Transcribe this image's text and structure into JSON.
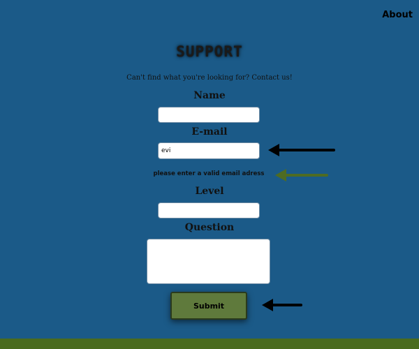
{
  "nav": {
    "about_label": "About"
  },
  "header": {
    "title": "SUPPORT",
    "subtitle": "Can't find what you're looking for? Contact us!"
  },
  "form": {
    "name_label": "Name",
    "name_value": "",
    "email_label": "E-mail",
    "email_value": "evi",
    "email_error": "please enter a valid email adress",
    "level_label": "Level",
    "level_value": "",
    "question_label": "Question",
    "question_value": "",
    "submit_label": "Submit"
  },
  "colors": {
    "background": "#1b5a88",
    "footer": "#4a6b1e",
    "submit_button": "#5f7a3c",
    "arrow_black": "#000000",
    "arrow_green": "#4e6b23"
  },
  "annotations": [
    {
      "icon": "arrow-left-icon",
      "color": "black",
      "points_to": "email-field"
    },
    {
      "icon": "arrow-left-icon",
      "color": "green",
      "points_to": "email-error-message"
    },
    {
      "icon": "arrow-left-icon",
      "color": "black",
      "points_to": "submit-button"
    }
  ]
}
